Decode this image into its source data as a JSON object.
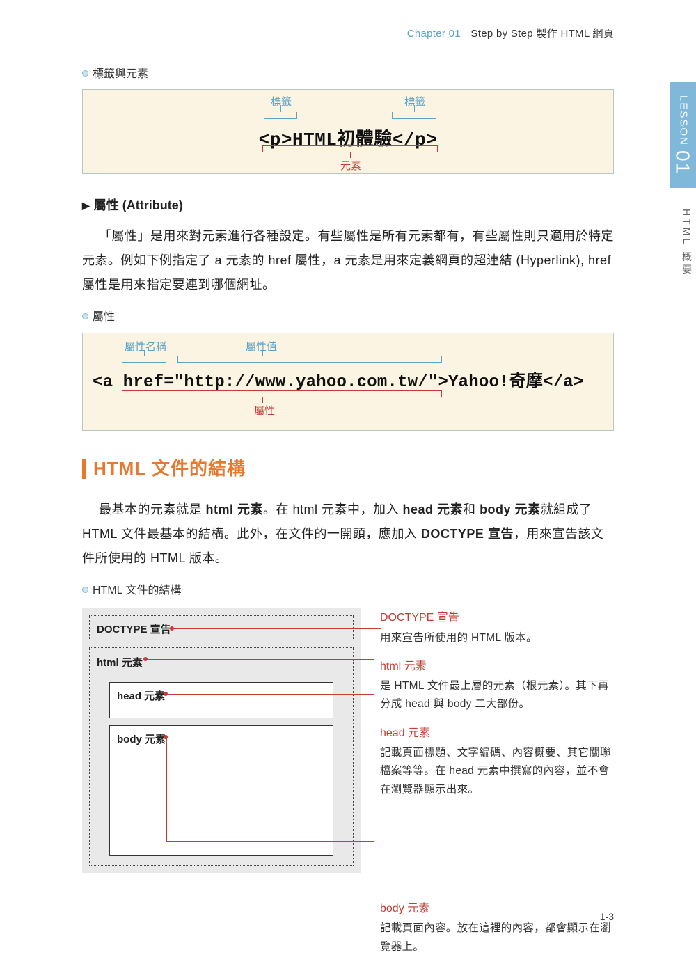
{
  "header": {
    "chapter": "Chapter 01",
    "title": "Step by Step 製作 HTML 網頁"
  },
  "sideTab": {
    "lesson": "LESSON",
    "num": "01",
    "sub": "HTML 概要"
  },
  "ex1": {
    "heading": "標籤與元素",
    "tagLabel": "標籤",
    "elementLabel": "元素",
    "code": "<p>HTML初體驗</p>"
  },
  "attr": {
    "heading": "屬性 (Attribute)",
    "para": "「屬性」是用來對元素進行各種設定。有些屬性是所有元素都有，有些屬性則只適用於特定元素。例如下例指定了 a 元素的 href 屬性，a 元素是用來定義網頁的超連結 (Hyperlink), href 屬性是用來指定要連到哪個網址。"
  },
  "ex2": {
    "heading": "屬性",
    "nameLabel": "屬性名稱",
    "valueLabel": "屬性值",
    "attrLabel": "屬性",
    "code": "<a href=\"http://www.yahoo.com.tw/\">Yahoo!奇摩</a>"
  },
  "section2": {
    "heading": "HTML 文件的結構",
    "para_pre": "最基本的元素就是 ",
    "b1": "html 元素",
    "para_mid1": "。在 html 元素中，加入 ",
    "b2": "head 元素",
    "para_mid2": "和 ",
    "b3": "body 元素",
    "para_mid3": "就組成了 HTML 文件最基本的結構。此外，在文件的一開頭，應加入 ",
    "b4": "DOCTYPE 宣告",
    "para_end": "，用來宣告該文件所使用的 HTML 版本。"
  },
  "structure": {
    "heading": "HTML 文件的結構",
    "doctype": "DOCTYPE 宣告",
    "html": "html 元素",
    "head": "head 元素",
    "body": "body 元素",
    "items": {
      "doctype": {
        "title": "DOCTYPE 宣告",
        "desc": "用來宣告所使用的 HTML 版本。"
      },
      "html": {
        "title": "html 元素",
        "desc": "是 HTML 文件最上層的元素（根元素）。其下再分成 head 與 body 二大部份。"
      },
      "head": {
        "title": "head 元素",
        "desc": "記載頁面標題、文字編碼、內容概要、其它關聯檔案等等。在 head 元素中撰寫的內容，並不會在瀏覽器顯示出來。"
      },
      "body": {
        "title": "body 元素",
        "desc": "記載頁面內容。放在這裡的內容，都會顯示在瀏覽器上。"
      }
    }
  },
  "pageNumber": "1-3"
}
